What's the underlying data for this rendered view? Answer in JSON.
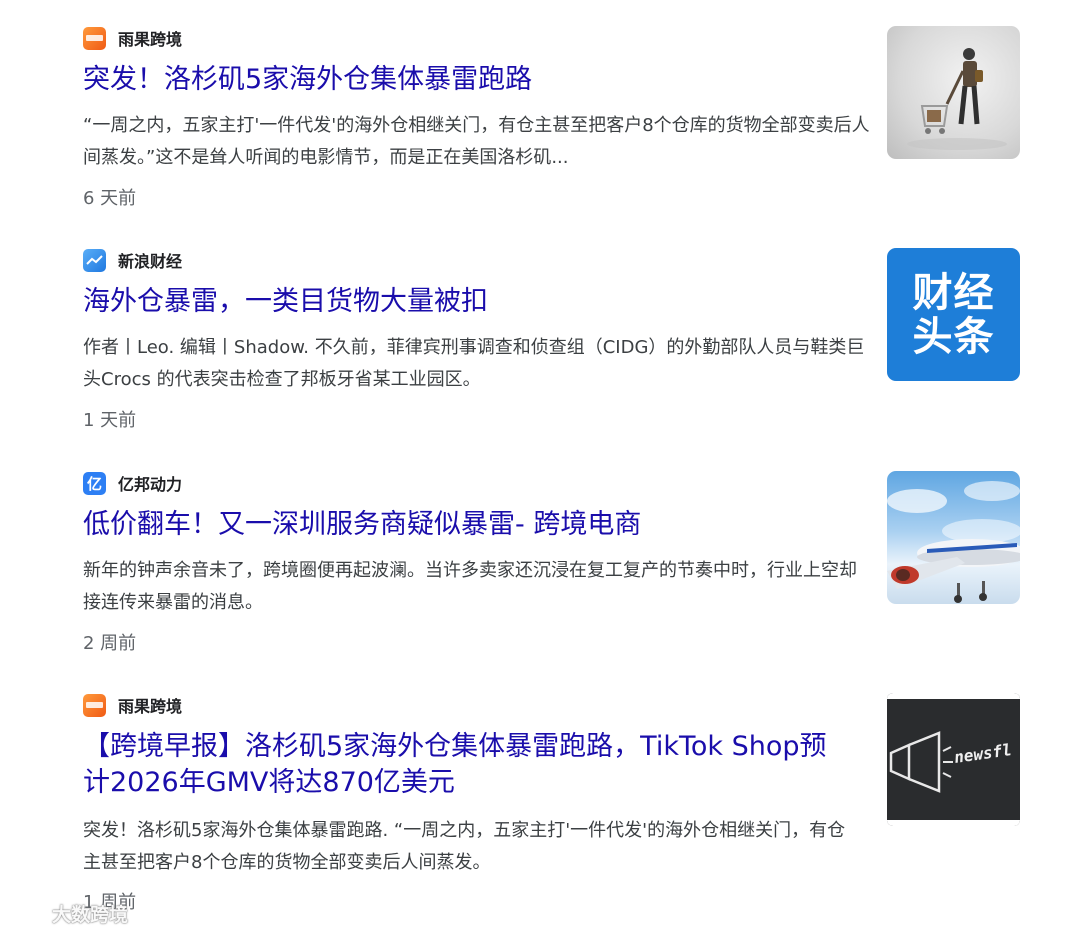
{
  "results": [
    {
      "source": "雨果跨境",
      "source_icon": "yuguo-logo-icon",
      "title": "突发！洛杉矶5家海外仓集体暴雷跑路",
      "snippet": "“一周之内，五家主打'一件代发'的海外仓相继关门，有仓主甚至把客户8个仓库的货物全部变卖后人间蒸发。”这不是耸人听闻的电影情节，而是正在美国洛杉矶...",
      "time": "6 天前",
      "thumbnail": "shopping-cart-figure-image"
    },
    {
      "source": "新浪财经",
      "source_icon": "sina-finance-logo-icon",
      "title": "海外仓暴雷，一类目货物大量被扣",
      "snippet": "作者丨Leo. 编辑丨Shadow. 不久前，菲律宾刑事调查和侦查组（CIDG）的外勤部队人员与鞋类巨头Crocs 的代表突击检查了邦板牙省某工业园区。",
      "time": "1 天前",
      "thumbnail_text": [
        "财经",
        "头条"
      ]
    },
    {
      "source": "亿邦动力",
      "source_icon": "yibang-logo-icon",
      "source_icon_char": "亿",
      "title": "低价翻车！又一深圳服务商疑似暴雷- 跨境电商",
      "snippet": "新年的钟声余音未了，跨境圈便再起波澜。当许多卖家还沉浸在复工复产的节奏中时，行业上空却接连传来暴雷的消息。",
      "time": "2 周前",
      "thumbnail": "airplane-sky-image"
    },
    {
      "source": "雨果跨境",
      "source_icon": "yuguo-logo-icon",
      "title": "【跨境早报】洛杉矶5家海外仓集体暴雷跑路，TikTok Shop预计2026年GMV将达870亿美元",
      "snippet": "突发！洛杉矶5家海外仓集体暴雷跑路. “一周之内，五家主打'一件代发'的海外仓相继关门，有仓主甚至把客户8个仓库的货物全部变卖后人间蒸发。",
      "time": "1 周前",
      "thumbnail_text": "newsfl"
    }
  ],
  "watermark": {
    "text": "大数跨境"
  },
  "colors": {
    "title_link": "#1a0dab",
    "snippet": "#3c4043",
    "meta": "#5f6368"
  }
}
